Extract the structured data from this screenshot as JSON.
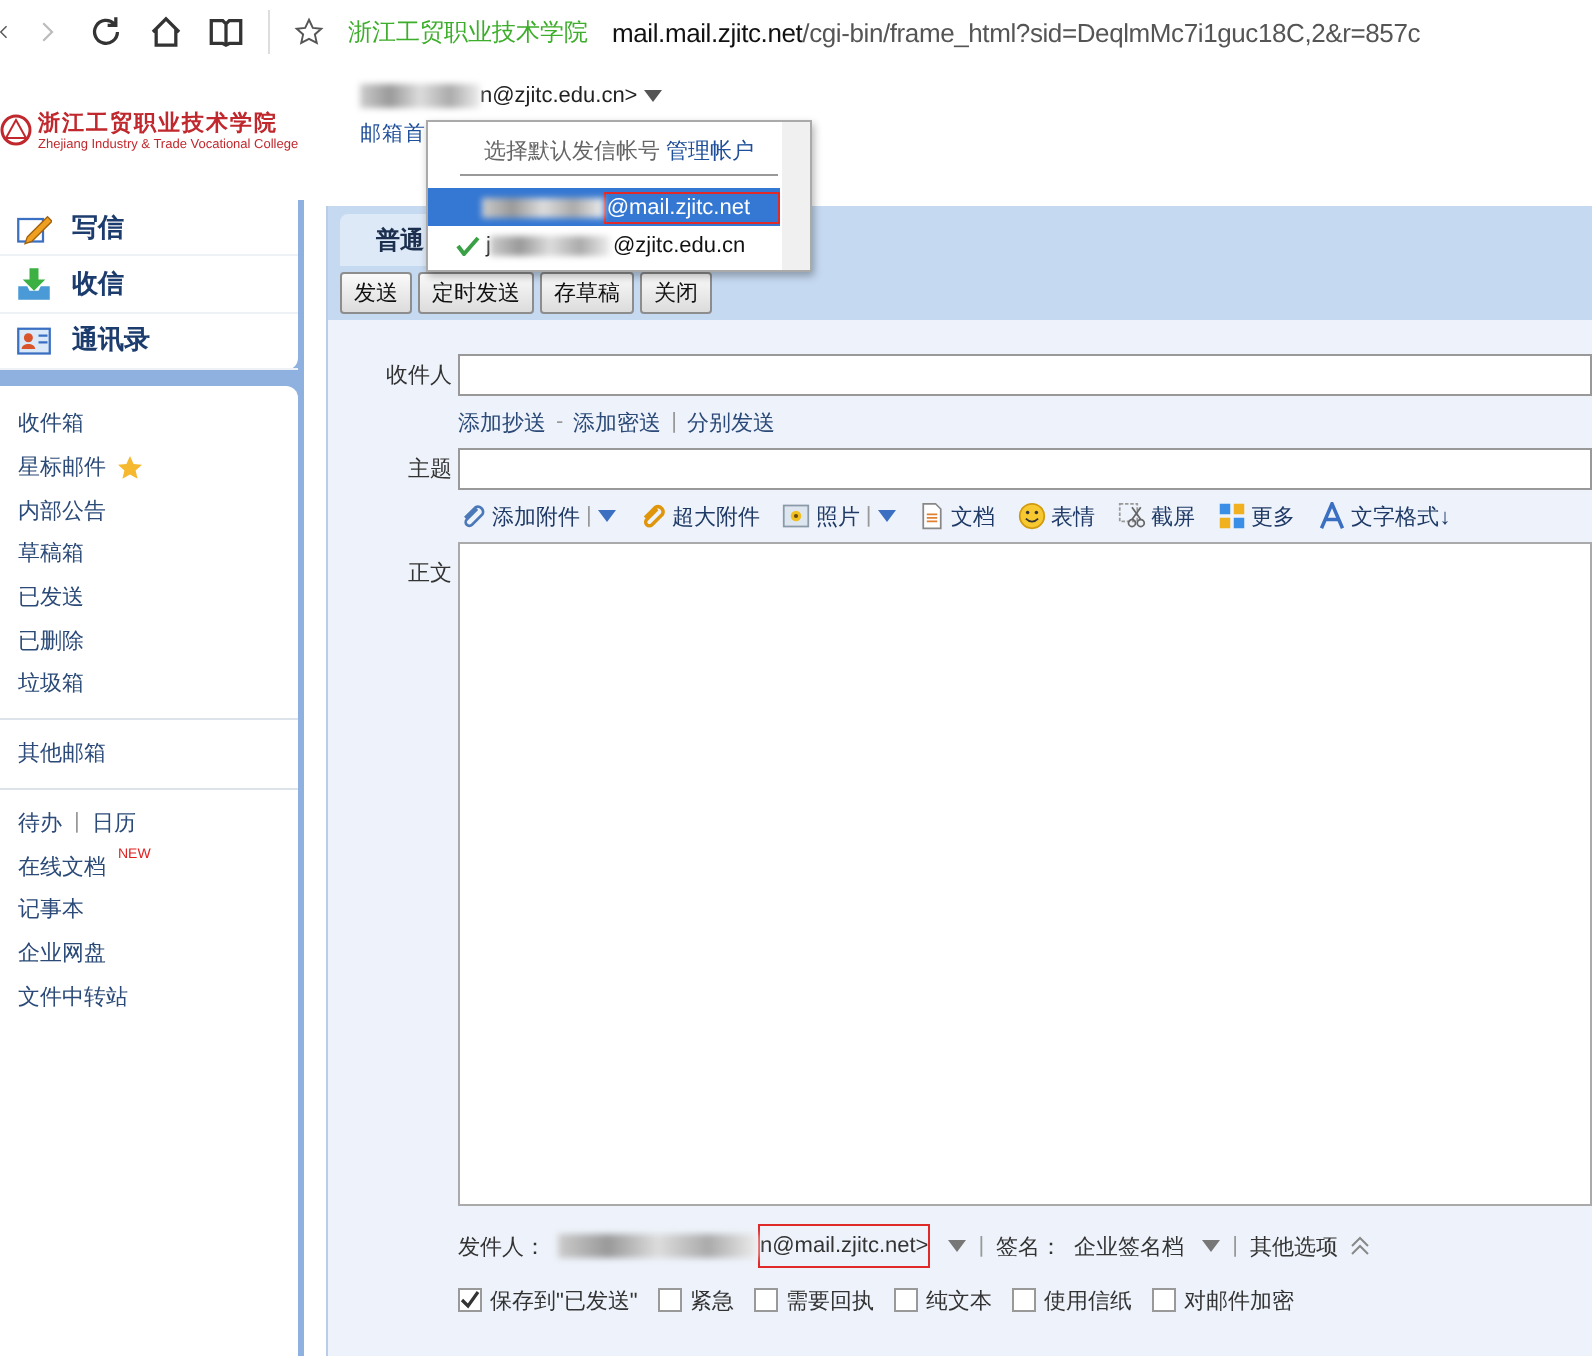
{
  "browser": {
    "site_name": "浙江工贸职业技术学院",
    "url_host": "mail.mail.zjitc.net",
    "url_path": "/cgi-bin/frame_html?sid=DeqlmMc7i1guc18C,2&r=857c"
  },
  "header": {
    "logo_name": "浙江工贸职业技术学院",
    "logo_subtitle": "Zhejiang Industry & Trade Vocational College",
    "account_suffix": "n@zjitc.edu.cn>",
    "home_link": "邮箱首"
  },
  "account_menu": {
    "title": "选择默认发信帐号",
    "manage_link": "管理帐户",
    "items": [
      {
        "suffix": "@mail.zjitc.net",
        "selected": true,
        "checked": false,
        "highlighted": true
      },
      {
        "prefix": "j",
        "suffix": "@zjitc.edu.cn",
        "selected": false,
        "checked": true,
        "highlighted": false
      }
    ]
  },
  "sidebar": {
    "nav": [
      {
        "kind": "write",
        "label": "写信"
      },
      {
        "kind": "inbox",
        "label": "收信"
      },
      {
        "kind": "contacts",
        "label": "通讯录"
      }
    ],
    "groups": [
      [
        {
          "label": "收件箱"
        },
        {
          "label": "星标邮件",
          "starred": true
        },
        {
          "label": "内部公告"
        },
        {
          "label": "草稿箱"
        },
        {
          "label": "已发送"
        },
        {
          "label": "已删除"
        },
        {
          "label": "垃圾箱"
        }
      ],
      [
        {
          "label": "其他邮箱"
        }
      ],
      [
        {
          "links": [
            {
              "kind": "link",
              "text": "待办"
            },
            {
              "kind": "sep",
              "text": "|"
            },
            {
              "kind": "link",
              "text": "日历"
            }
          ]
        },
        {
          "label": "在线文档",
          "badge": "NEW"
        },
        {
          "label": "记事本"
        },
        {
          "label": "企业网盘"
        },
        {
          "label": "文件中转站"
        }
      ]
    ]
  },
  "tab": {
    "label": "普通"
  },
  "toolbar": [
    "发送",
    "定时发送",
    "存草稿",
    "关闭"
  ],
  "compose": {
    "to_label": "收件人",
    "extra_links": [
      {
        "kind": "link",
        "text": "添加抄送"
      },
      {
        "kind": "sep",
        "text": "-"
      },
      {
        "kind": "link",
        "text": "添加密送"
      },
      {
        "kind": "sep",
        "text": "|"
      },
      {
        "kind": "link",
        "text": "分别发送"
      }
    ],
    "subject_label": "主题",
    "attach_tools": [
      {
        "kind": "clip",
        "label": "添加附件",
        "split": "|"
      },
      {
        "kind": "bigclip",
        "label": "超大附件"
      },
      {
        "kind": "photo",
        "label": "照片",
        "split": "|"
      },
      {
        "kind": "doc",
        "label": "文档"
      },
      {
        "kind": "smile",
        "label": "表情"
      },
      {
        "kind": "scissors",
        "label": "截屏"
      },
      {
        "kind": "grid",
        "label": "更多"
      },
      {
        "kind": "font",
        "label": "文字格式↓"
      }
    ],
    "body_label": "正文",
    "sender_label": "发件人：",
    "sender_suffix": "n@mail.zjitc.net>",
    "sender_highlighted": true,
    "divider_1": "|",
    "signature_label": "签名：",
    "signature_value": "企业签名档",
    "divider_2": "|",
    "more_options": "其他选项",
    "options": [
      {
        "label": "保存到\"已发送\"",
        "checked": true
      },
      {
        "label": "紧急",
        "checked": false
      },
      {
        "label": "需要回执",
        "checked": false
      },
      {
        "label": "纯文本",
        "checked": false
      },
      {
        "label": "使用信纸",
        "checked": false
      },
      {
        "label": "对邮件加密",
        "checked": false
      }
    ]
  }
}
